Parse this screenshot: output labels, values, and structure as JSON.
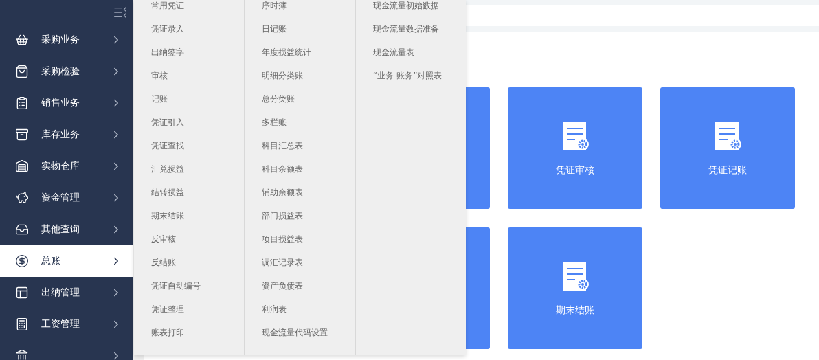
{
  "sidebar": {
    "items": [
      {
        "label": "采购业务",
        "selected": false
      },
      {
        "label": "采购检验",
        "selected": false
      },
      {
        "label": "销售业务",
        "selected": false
      },
      {
        "label": "库存业务",
        "selected": false
      },
      {
        "label": "实物仓库",
        "selected": false
      },
      {
        "label": "资金管理",
        "selected": false
      },
      {
        "label": "其他查询",
        "selected": false
      },
      {
        "label": "总账",
        "selected": true
      },
      {
        "label": "出纳管理",
        "selected": false
      },
      {
        "label": "工资管理",
        "selected": false
      }
    ]
  },
  "submenu": {
    "columns": [
      [
        "常用凭证",
        "凭证录入",
        "出纳签字",
        "审核",
        "记账",
        "凭证引入",
        "凭证查找",
        "汇兑损益",
        "结转损益",
        "期末结账",
        "反审核",
        "反结账",
        "凭证自动编号",
        "凭证整理",
        "账表打印"
      ],
      [
        "序时簿",
        "日记账",
        "年度损益统计",
        "明细分类账",
        "总分类账",
        "多栏账",
        "科目汇总表",
        "科目余额表",
        "辅助余额表",
        "部门损益表",
        "项目损益表",
        "调汇记录表",
        "资产负债表",
        "利润表",
        "现金流量代码设置"
      ],
      [
        "现金流量初始数据",
        "现金流量数据准备",
        "现金流量表",
        "“业务-账务”对照表"
      ]
    ]
  },
  "cards": [
    [
      {
        "kind": "partial"
      },
      {
        "kind": "full",
        "label": "凭证审核"
      },
      {
        "kind": "full",
        "label": "凭证记账"
      }
    ],
    [
      {
        "kind": "partial"
      },
      {
        "kind": "full",
        "label": "期末结账"
      }
    ]
  ]
}
